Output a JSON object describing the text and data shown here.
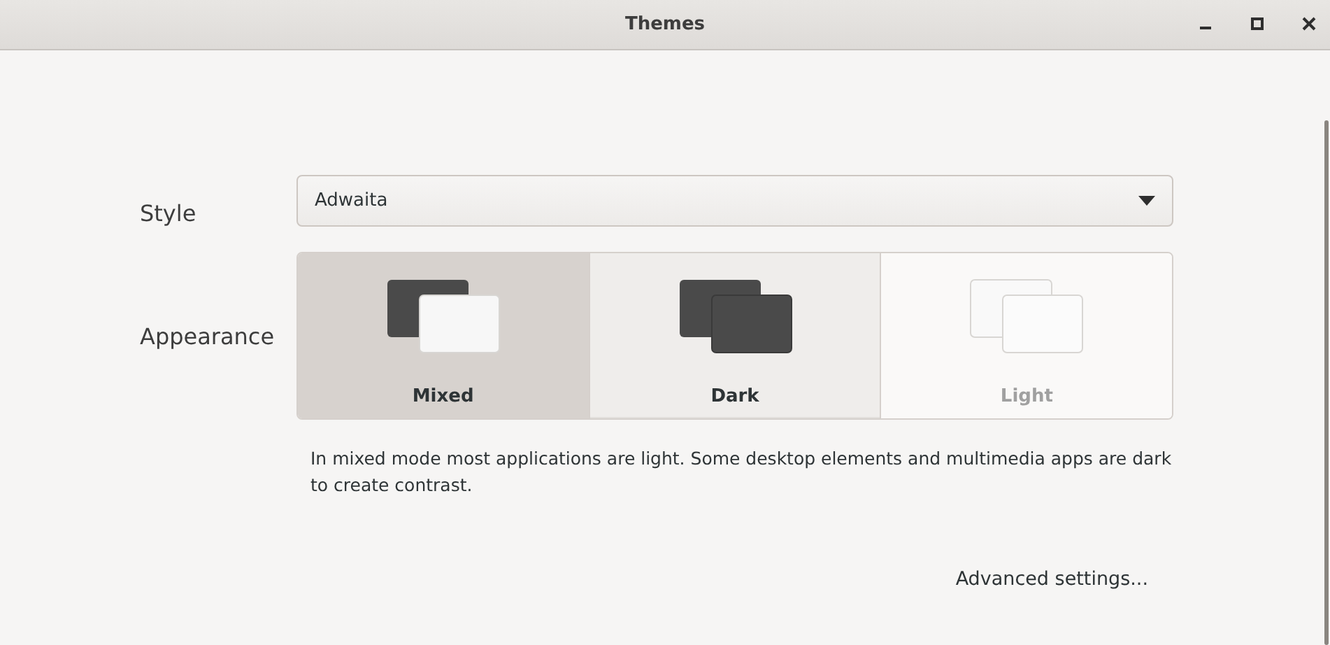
{
  "window": {
    "title": "Themes"
  },
  "style": {
    "label": "Style",
    "value": "Adwaita"
  },
  "appearance": {
    "label": "Appearance",
    "options": [
      {
        "kind": "mixed",
        "label": "Mixed",
        "selected": true,
        "hovered": false
      },
      {
        "kind": "dark",
        "label": "Dark",
        "selected": false,
        "hovered": true
      },
      {
        "kind": "light",
        "label": "Light",
        "selected": false,
        "hovered": false
      }
    ]
  },
  "description": "In mixed mode most applications are light. Some desktop elements and multimedia apps are dark to create contrast.",
  "advanced_link": "Advanced settings..."
}
